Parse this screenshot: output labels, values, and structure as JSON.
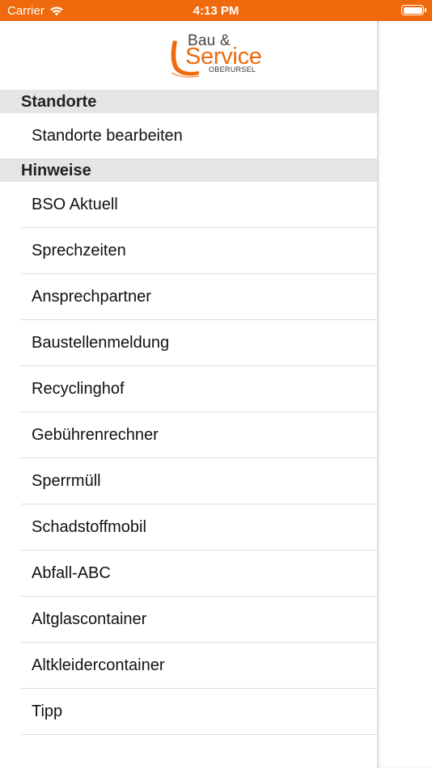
{
  "status_bar": {
    "carrier": "Carrier",
    "time": "4:13 PM"
  },
  "logo": {
    "line1": "Bau &",
    "line2": "Service",
    "line3": "OBERURSEL"
  },
  "sections": [
    {
      "title": "Standorte",
      "items": [
        "Standorte bearbeiten"
      ]
    },
    {
      "title": "Hinweise",
      "items": [
        "BSO Aktuell",
        "Sprechzeiten",
        "Ansprechpartner",
        "Baustellenmeldung",
        "Recyclinghof",
        "Gebührenrechner",
        "Sperrmüll",
        "Schadstoffmobil",
        "Abfall-ABC",
        "Altglascontainer",
        "Altkleidercontainer",
        "Tipp"
      ]
    }
  ],
  "colors": {
    "accent": "#ee6a0c",
    "section_bg": "#e5e5e5"
  },
  "icons": [
    "wifi-icon",
    "battery-icon"
  ]
}
